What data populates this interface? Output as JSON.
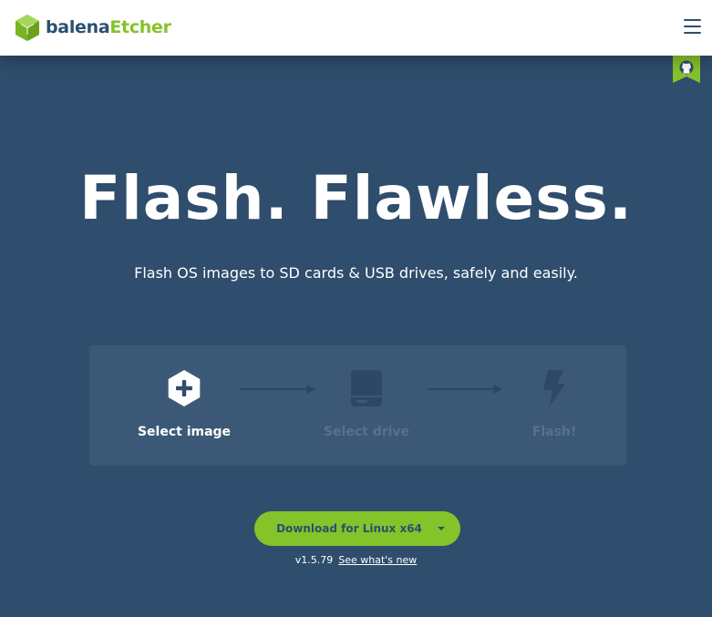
{
  "header": {
    "logo": {
      "brand_prefix": "balena",
      "brand_name": "Etcher",
      "icon": "balena-cube-icon"
    },
    "menu_icon": "hamburger-menu-icon",
    "github_icon": "github-icon"
  },
  "hero": {
    "title": "Flash. Flawless.",
    "subtitle": "Flash OS images to SD cards & USB drives, safely and easily."
  },
  "app_preview": {
    "steps": [
      {
        "label": "Select image",
        "icon": "plus-hexagon-icon",
        "state": "active"
      },
      {
        "label": "Select drive",
        "icon": "drive-icon",
        "state": "disabled"
      },
      {
        "label": "Flash!",
        "icon": "lightning-icon",
        "state": "disabled"
      }
    ]
  },
  "download": {
    "button_label": "Download for Linux x64",
    "dropdown_icon": "caret-down-icon",
    "version": "v1.5.79",
    "whats_new_link": "See what's new"
  },
  "colors": {
    "background": "#2f4d6c",
    "panel": "#3b5977",
    "accent": "#85c32a",
    "brand_dark": "#2a506f",
    "disabled": "#55718d"
  }
}
